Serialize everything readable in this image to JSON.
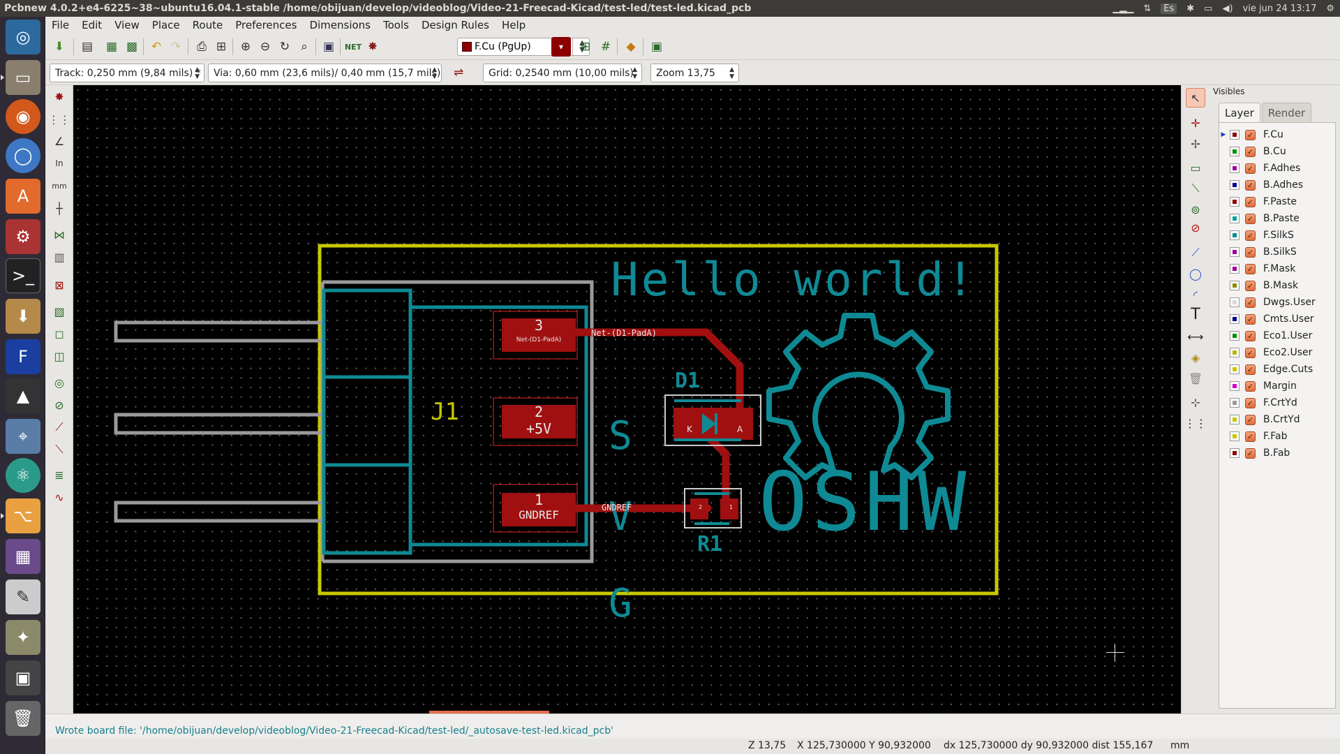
{
  "window_title": "Pcbnew 4.0.2+e4-6225~38~ubuntu16.04.1-stable /home/obijuan/develop/videoblog/Video-21-Freecad-Kicad/test-led/test-led.kicad_pcb",
  "system_tray": {
    "keyboard": "Es",
    "clock": "vie jun 24 13:17"
  },
  "menu": [
    "File",
    "Edit",
    "View",
    "Place",
    "Route",
    "Preferences",
    "Dimensions",
    "Tools",
    "Design Rules",
    "Help"
  ],
  "active_layer": "F.Cu (PgUp)",
  "track_width": "Track: 0,250 mm (9,84 mils) *",
  "via_size": "Via: 0,60 mm (23,6 mils)/ 0,40 mm (15,7 mils) *",
  "grid": "Grid: 0,2540 mm (10,00 mils)",
  "zoom": "Zoom 13,75",
  "visibles": {
    "title": "Visibles",
    "tabs": [
      "Layer",
      "Render"
    ],
    "layers": [
      {
        "name": "F.Cu",
        "color": "#8b0000",
        "active": true
      },
      {
        "name": "B.Cu",
        "color": "#009000",
        "active": false
      },
      {
        "name": "F.Adhes",
        "color": "#a000a0",
        "active": false
      },
      {
        "name": "B.Adhes",
        "color": "#00008b",
        "active": false
      },
      {
        "name": "F.Paste",
        "color": "#8b0000",
        "active": false
      },
      {
        "name": "B.Paste",
        "color": "#00a0a0",
        "active": false
      },
      {
        "name": "F.SilkS",
        "color": "#008b8b",
        "active": false
      },
      {
        "name": "B.SilkS",
        "color": "#a000a0",
        "active": false
      },
      {
        "name": "F.Mask",
        "color": "#a000a0",
        "active": false
      },
      {
        "name": "B.Mask",
        "color": "#8b8b00",
        "active": false
      },
      {
        "name": "Dwgs.User",
        "color": "#d8d8d8",
        "active": false
      },
      {
        "name": "Cmts.User",
        "color": "#00008b",
        "active": false
      },
      {
        "name": "Eco1.User",
        "color": "#009000",
        "active": false
      },
      {
        "name": "Eco2.User",
        "color": "#b8b800",
        "active": false
      },
      {
        "name": "Edge.Cuts",
        "color": "#c8c800",
        "active": false
      },
      {
        "name": "Margin",
        "color": "#d000d0",
        "active": false
      },
      {
        "name": "F.CrtYd",
        "color": "#9a9a9a",
        "active": false
      },
      {
        "name": "B.CrtYd",
        "color": "#c8c800",
        "active": false
      },
      {
        "name": "F.Fab",
        "color": "#c8c800",
        "active": false
      },
      {
        "name": "B.Fab",
        "color": "#8b0000",
        "active": false
      }
    ]
  },
  "board": {
    "silk_text": "Hello world!",
    "logo_text": "OSHW",
    "connector_ref": "J1",
    "pin_labels": [
      "S",
      "V",
      "G"
    ],
    "pads": [
      {
        "num": "3",
        "net": "Net-(D1-PadA)"
      },
      {
        "num": "2",
        "net": "+5V"
      },
      {
        "num": "1",
        "net": "GNDREF"
      }
    ],
    "track_labels": [
      "Net-(D1-PadA)",
      "GNDREF"
    ],
    "d1_ref": "D1",
    "d1_pad_k": "K",
    "d1_pad_a": "A",
    "r1_ref": "R1",
    "r1_pad_2": "2",
    "r1_pad_1": "1"
  },
  "message": "Wrote board file: '/home/obijuan/develop/videoblog/Video-21-Freecad-Kicad/test-led/_autosave-test-led.kicad_pcb'",
  "status": {
    "zoom": "Z 13,75",
    "abs": "X 125,730000  Y 90,932000",
    "rel": "dx 125,730000  dy 90,932000  dist 155,167",
    "units": "mm"
  }
}
